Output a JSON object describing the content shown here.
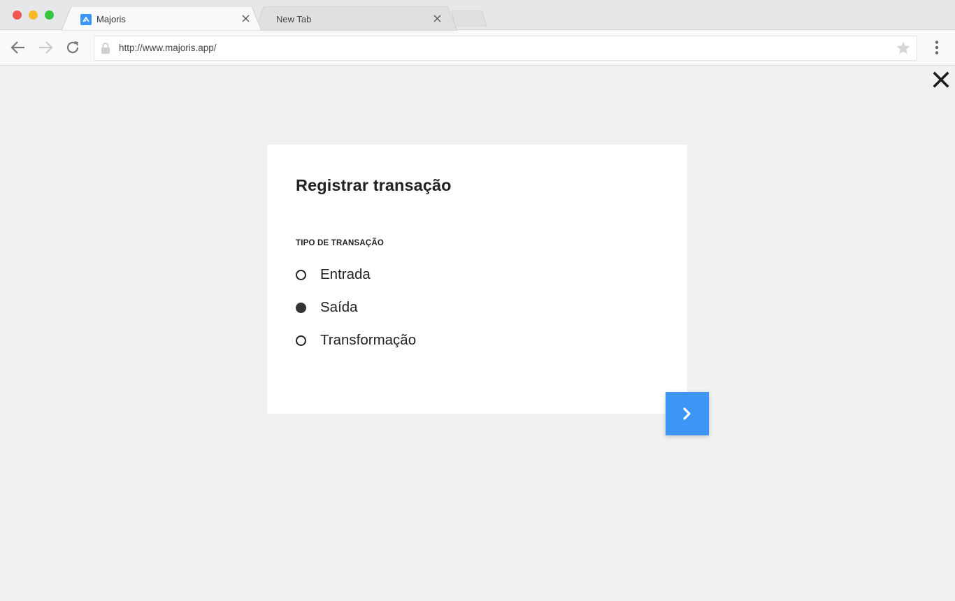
{
  "browser": {
    "tabs": [
      {
        "title": "Majoris",
        "active": true
      },
      {
        "title": "New Tab",
        "active": false
      }
    ],
    "url": "http://www.majoris.app/",
    "icons": {
      "back": "back-arrow-icon",
      "forward": "forward-arrow-icon",
      "reload": "reload-icon",
      "lock": "lock-icon",
      "bookmark": "star-icon",
      "menu": "kebab-menu-icon"
    }
  },
  "page": {
    "title": "Registrar transação",
    "section_label": "TIPO DE TRANSAÇÃO",
    "options": [
      {
        "label": "Entrada",
        "selected": false
      },
      {
        "label": "Saída",
        "selected": true
      },
      {
        "label": "Transformação",
        "selected": false
      }
    ]
  },
  "colors": {
    "accent": "#3d95f5",
    "page_background": "#f1f1f1",
    "card_background": "#ffffff",
    "text": "#222222"
  }
}
